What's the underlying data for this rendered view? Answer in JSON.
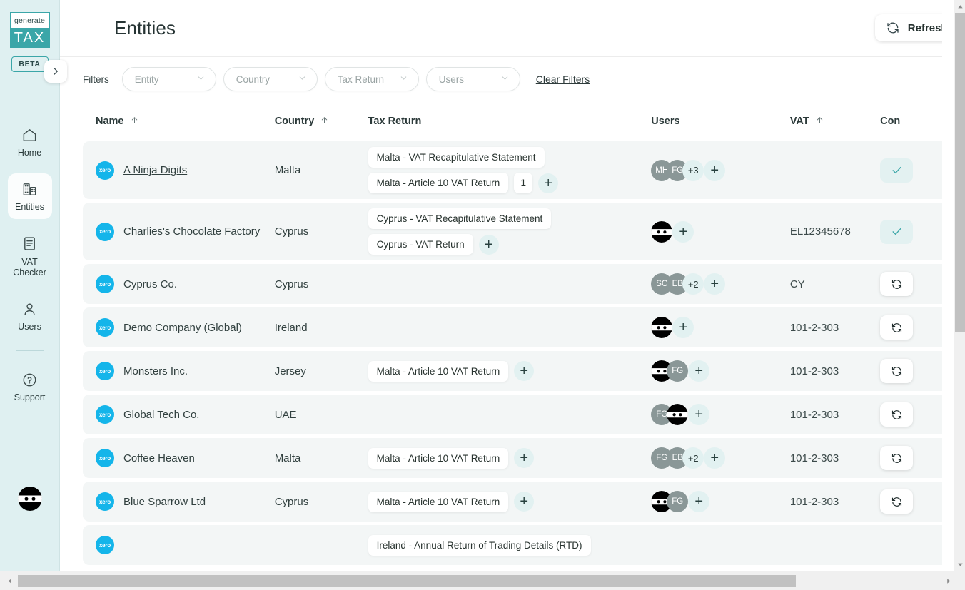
{
  "sidebar": {
    "logo_top": "generate",
    "logo_bottom": "TAX",
    "beta_badge": "BETA",
    "toggle_icon": "chevron-right-icon",
    "items": [
      {
        "label": "Home",
        "icon": "home-icon",
        "active": false
      },
      {
        "label": "Entities",
        "icon": "buildings-icon",
        "active": true
      },
      {
        "label": "VAT Checker",
        "icon": "document-icon",
        "active": false
      },
      {
        "label": "Users",
        "icon": "person-icon",
        "active": false
      },
      {
        "label": "Support",
        "icon": "question-circle-icon",
        "active": false
      }
    ],
    "avatar": "ninja-avatar"
  },
  "header": {
    "title": "Entities",
    "refresh_label": "Refresh Entities",
    "refresh_icon": "refresh-icon"
  },
  "filters": {
    "label": "Filters",
    "chips": [
      {
        "placeholder": "Entity"
      },
      {
        "placeholder": "Country"
      },
      {
        "placeholder": "Tax Return"
      },
      {
        "placeholder": "Users"
      }
    ],
    "clear_label": "Clear Filters"
  },
  "table": {
    "columns": [
      {
        "label": "Name",
        "sortable": true
      },
      {
        "label": "Country",
        "sortable": true
      },
      {
        "label": "Tax Return",
        "sortable": false
      },
      {
        "label": "Users",
        "sortable": false
      },
      {
        "label": "VAT",
        "sortable": true
      },
      {
        "label": "Con",
        "sortable": false
      }
    ],
    "rows": [
      {
        "logo": "xero",
        "logo_text": "xero",
        "name": "A Ninja Digits",
        "name_link": true,
        "country": "Malta",
        "tax_returns": [
          "Malta - VAT Recapitulative Statement",
          "Malta - Article 10 VAT Return"
        ],
        "tax_count": "1",
        "users": [
          {
            "type": "initials",
            "text": "MH"
          },
          {
            "type": "initials",
            "text": "FG"
          },
          {
            "type": "more",
            "text": "+3"
          }
        ],
        "vat": "",
        "connection": "ok"
      },
      {
        "logo": "xero",
        "logo_text": "xero",
        "name": "Charlies's Chocolate Factory",
        "name_link": false,
        "country": "Cyprus",
        "tax_returns": [
          "Cyprus - VAT Recapitulative Statement",
          "Cyprus - VAT Return"
        ],
        "tax_count": "",
        "users": [
          {
            "type": "ninja",
            "text": ""
          }
        ],
        "vat": "EL12345678",
        "connection": "ok"
      },
      {
        "logo": "xero",
        "logo_text": "xero",
        "name": "Cyprus Co.",
        "name_link": false,
        "country": "Cyprus",
        "tax_returns": [],
        "tax_count": "",
        "users": [
          {
            "type": "initials",
            "text": "SC"
          },
          {
            "type": "initials",
            "text": "EB"
          },
          {
            "type": "more",
            "text": "+2"
          }
        ],
        "vat": "CY",
        "connection": "sync"
      },
      {
        "logo": "xero",
        "logo_text": "xero",
        "name": "Demo Company (Global)",
        "name_link": false,
        "country": "Ireland",
        "tax_returns": [],
        "tax_count": "",
        "users": [
          {
            "type": "ninja",
            "text": ""
          }
        ],
        "vat": "101-2-303",
        "connection": "sync"
      },
      {
        "logo": "xero",
        "logo_text": "xero",
        "name": "Monsters Inc.",
        "name_link": false,
        "country": "Jersey",
        "tax_returns": [
          "Malta - Article 10 VAT Return"
        ],
        "tax_count": "",
        "users": [
          {
            "type": "ninja",
            "text": ""
          },
          {
            "type": "initials",
            "text": "FG"
          }
        ],
        "vat": "101-2-303",
        "connection": "sync"
      },
      {
        "logo": "xero",
        "logo_text": "xero",
        "name": "Global Tech Co.",
        "name_link": false,
        "country": "UAE",
        "tax_returns": [],
        "tax_count": "",
        "users": [
          {
            "type": "initials",
            "text": "FG"
          },
          {
            "type": "ninja",
            "text": ""
          }
        ],
        "vat": "101-2-303",
        "connection": "sync"
      },
      {
        "logo": "xero",
        "logo_text": "xero",
        "name": "Coffee Heaven",
        "name_link": false,
        "country": "Malta",
        "tax_returns": [
          "Malta - Article 10 VAT Return"
        ],
        "tax_count": "",
        "users": [
          {
            "type": "initials",
            "text": "FG"
          },
          {
            "type": "initials",
            "text": "EB"
          },
          {
            "type": "more",
            "text": "+2"
          }
        ],
        "vat": "101-2-303",
        "connection": "sync"
      },
      {
        "logo": "xero",
        "logo_text": "xero",
        "name": "Blue Sparrow Ltd",
        "name_link": false,
        "country": "Cyprus",
        "tax_returns": [
          "Malta - Article 10 VAT Return"
        ],
        "tax_count": "",
        "users": [
          {
            "type": "ninja",
            "text": ""
          },
          {
            "type": "initials",
            "text": "FG"
          }
        ],
        "vat": "101-2-303",
        "connection": "sync"
      },
      {
        "logo": "xero",
        "logo_text": "xero",
        "name": "",
        "name_link": false,
        "country": "",
        "tax_returns": [
          "Ireland - Annual Return of Trading Details (RTD)"
        ],
        "tax_count": "",
        "users": [],
        "vat": "",
        "connection": ""
      }
    ]
  },
  "colors": {
    "sidebar_bg": "#dff0f1",
    "brand_teal": "#3aa6a8",
    "xero_blue": "#14b5ea",
    "row_bg": "#f3f6f6",
    "accent_soft": "#e2f1f1"
  },
  "scrollbars": {
    "vertical_thumb_top_pct": 2,
    "horizontal_thumb_left_pct": 2
  }
}
